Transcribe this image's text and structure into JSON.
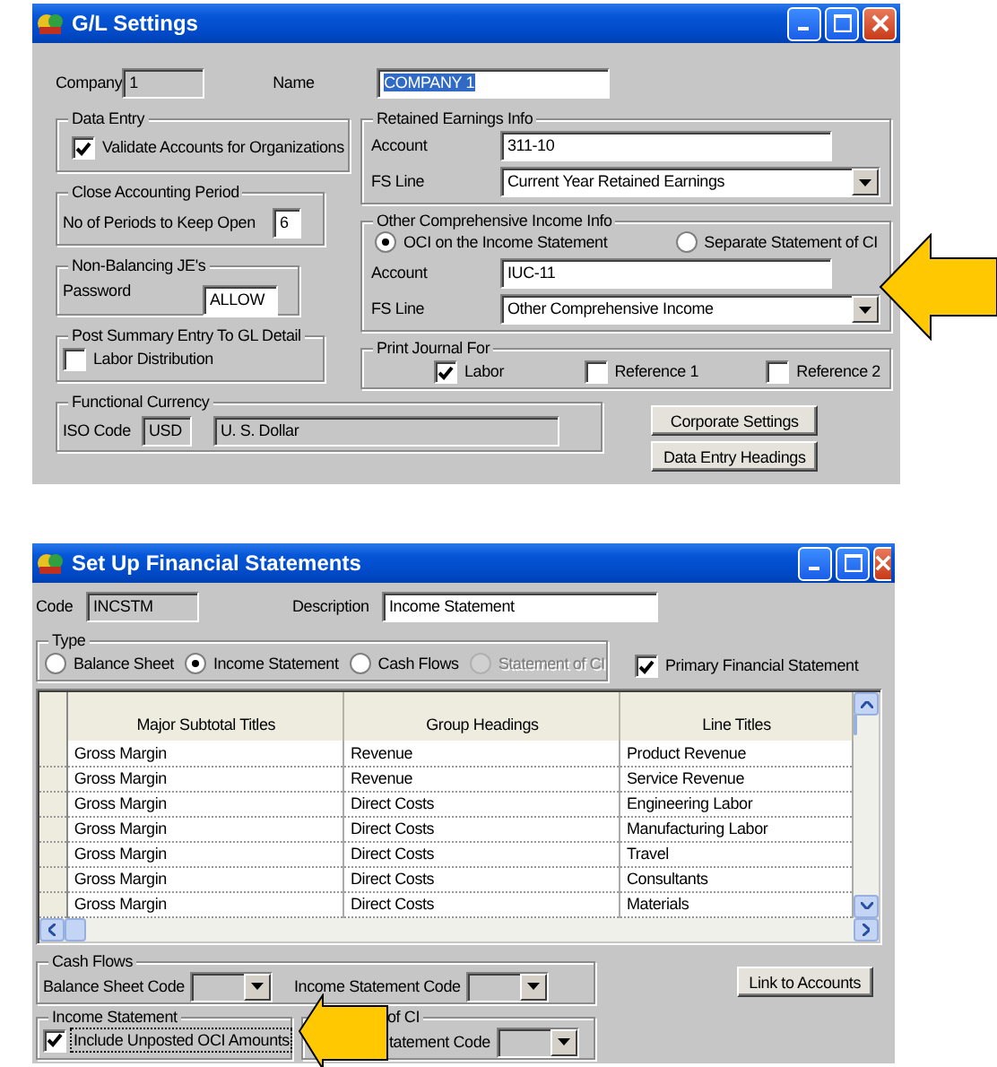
{
  "gl_settings": {
    "title": "G/L Settings",
    "company": {
      "label": "Company",
      "value": "1"
    },
    "name": {
      "label": "Name",
      "value": "COMPANY 1",
      "text_selected": true
    },
    "data_entry": {
      "title": "Data Entry",
      "checkbox": {
        "label": "Validate Accounts for Organizations",
        "checked": true
      }
    },
    "close_period": {
      "title": "Close Accounting Period",
      "label": "No of Periods to Keep Open",
      "value": "6"
    },
    "non_balancing": {
      "title": "Non-Balancing JE's",
      "label": "Password",
      "value": "ALLOW"
    },
    "post_summary": {
      "title": "Post Summary Entry To GL Detail",
      "checkbox": {
        "label": "Labor Distribution",
        "checked": false
      }
    },
    "retained_earnings": {
      "title": "Retained Earnings Info",
      "account_label": "Account",
      "account": "311-10",
      "fs_line_label": "FS Line",
      "fs_line": "Current Year Retained Earnings"
    },
    "oci": {
      "title": "Other Comprehensive Income Info",
      "options": [
        {
          "label": "OCI on the Income Statement",
          "selected": true
        },
        {
          "label": "Separate Statement of CI",
          "selected": false
        }
      ],
      "account_label": "Account",
      "account": "IUC-11",
      "fs_line_label": "FS Line",
      "fs_line": "Other Comprehensive Income"
    },
    "print_journal": {
      "title": "Print Journal For",
      "options": [
        {
          "label": "Labor",
          "checked": true
        },
        {
          "label": "Reference 1",
          "checked": false
        },
        {
          "label": "Reference 2",
          "checked": false
        }
      ]
    },
    "functional_currency": {
      "title": "Functional Currency",
      "label": "ISO Code",
      "code": "USD",
      "name": "U. S. Dollar"
    },
    "buttons": [
      "Corporate Settings",
      "Data Entry Headings"
    ]
  },
  "financial_statements": {
    "title": "Set Up Financial Statements",
    "code": {
      "label": "Code",
      "value": "INCSTM"
    },
    "description": {
      "label": "Description",
      "value": "Income Statement"
    },
    "type": {
      "title": "Type",
      "options": [
        {
          "label": "Balance Sheet",
          "selected": false,
          "disabled": false
        },
        {
          "label": "Income Statement",
          "selected": true,
          "disabled": false
        },
        {
          "label": "Cash Flows",
          "selected": false,
          "disabled": false
        },
        {
          "label": "Statement of CI",
          "selected": false,
          "disabled": true
        }
      ]
    },
    "primary": {
      "label": "Primary Financial Statement",
      "checked": true
    },
    "table": {
      "columns": [
        "Major Subtotal Titles",
        "Group Headings",
        "Line Titles"
      ],
      "rows": [
        [
          "Gross Margin",
          "Revenue",
          "Product Revenue"
        ],
        [
          "Gross Margin",
          "Revenue",
          "Service Revenue"
        ],
        [
          "Gross Margin",
          "Direct Costs",
          "Engineering Labor"
        ],
        [
          "Gross Margin",
          "Direct Costs",
          "Manufacturing Labor"
        ],
        [
          "Gross Margin",
          "Direct Costs",
          "Travel"
        ],
        [
          "Gross Margin",
          "Direct Costs",
          "Consultants"
        ],
        [
          "Gross Margin",
          "Direct Costs",
          "Materials"
        ]
      ]
    },
    "cash_flows": {
      "title": "Cash Flows",
      "fields": [
        {
          "label": "Balance Sheet Code",
          "disabled": true
        },
        {
          "label": "Income Statement Code",
          "disabled": true
        }
      ]
    },
    "link_button": "Link to Accounts",
    "income_statement": {
      "title": "Income Statement",
      "checkbox": {
        "label": "Include Unposted OCI Amounts",
        "checked": true,
        "focused": true
      }
    },
    "statement_of_ci": {
      "title": "of CI",
      "label": "tatement Code",
      "disabled": true
    }
  }
}
